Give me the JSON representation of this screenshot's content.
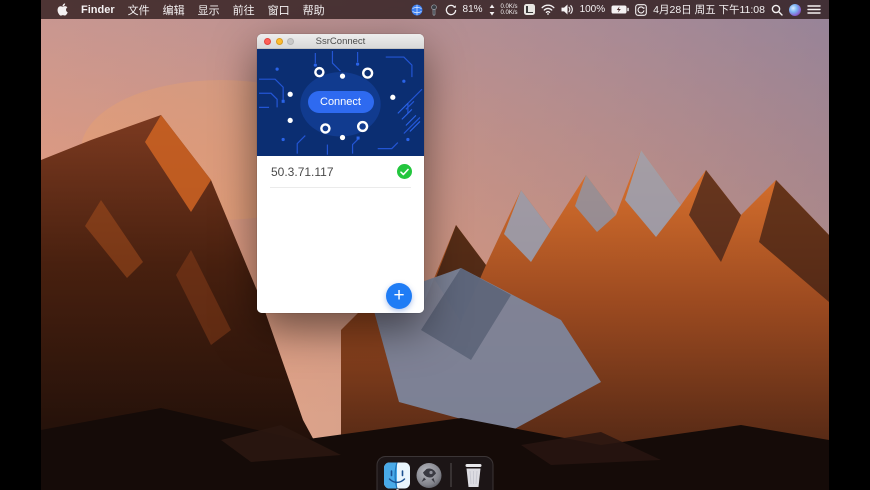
{
  "menu_bar": {
    "app_name": "Finder",
    "menus": [
      "文件",
      "编辑",
      "显示",
      "前往",
      "窗口",
      "帮助"
    ],
    "status": {
      "monitor_percent": "81%",
      "net_up": "0.0K/s",
      "net_down": "0.0K/s",
      "battery_percent": "100%",
      "clock": "4月28日 周五 下午11:08"
    }
  },
  "window": {
    "title": "SsrConnect",
    "connect_button_label": "Connect",
    "servers": [
      {
        "address": "50.3.71.117",
        "status": "connected"
      }
    ],
    "add_button_label": "+"
  },
  "dock": {
    "items": [
      {
        "name": "Finder",
        "running": true
      },
      {
        "name": "Launchpad",
        "running": false
      },
      {
        "name": "Trash",
        "running": false
      }
    ]
  },
  "icons": {
    "apple": "apple-logo",
    "net_arrows": "up-down-arrows",
    "wifi": "wifi-arcs",
    "volume": "speaker-waves",
    "battery": "battery-full",
    "sync": "sync-square",
    "search": "magnifier",
    "siri": "siri-orb",
    "notification_center": "list-lines",
    "server_status": "green-check-circle",
    "add": "plus-circle"
  },
  "colors": {
    "header_navy": "#0b2e72",
    "accent_blue": "#2e6af0",
    "fab_blue": "#1f7cf5",
    "success_green": "#23c63e"
  }
}
